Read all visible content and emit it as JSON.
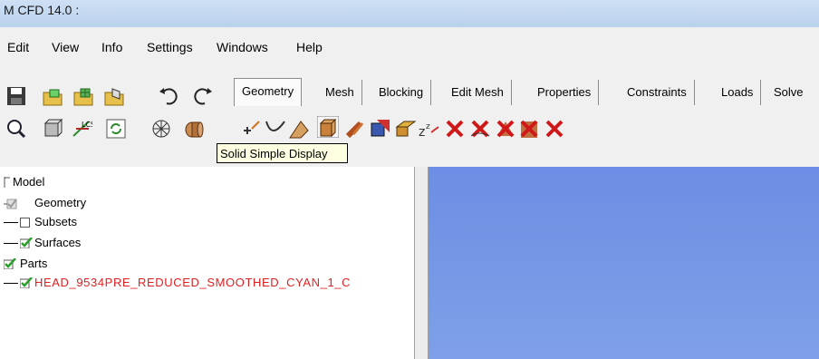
{
  "window": {
    "title": "M CFD 14.0 :"
  },
  "menu": [
    "Edit",
    "View",
    "Info",
    "Settings",
    "Windows",
    "Help"
  ],
  "tabs": [
    "Geometry",
    "Mesh",
    "Blocking",
    "Edit Mesh",
    "Properties",
    "Constraints",
    "Loads",
    "Solve"
  ],
  "active_tab": "Geometry",
  "tooltip": {
    "text": "Solid Simple Display"
  },
  "tree": {
    "model": "Model",
    "geometry": "Geometry",
    "subsets": "Subsets",
    "surfaces": "Surfaces",
    "parts": "Parts",
    "part_name": "HEAD_9534PRE_REDUCED_SMOOTHED_CYAN_1_C"
  },
  "colors": {
    "viewport_top": "#6c8ee4",
    "viewport_bottom": "#7fa0e8",
    "part_text": "#e02020",
    "check_green": "#2aa02a",
    "delete_red": "#d01818"
  }
}
